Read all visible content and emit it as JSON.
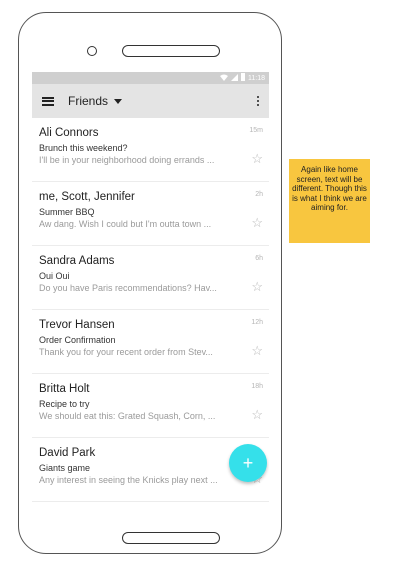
{
  "status_bar": {
    "time": "11:18"
  },
  "app_bar": {
    "title": "Friends"
  },
  "messages": [
    {
      "name": "Ali Connors",
      "subject": "Brunch this weekend?",
      "preview": "I'll be in your neighborhood doing errands ...",
      "time": "15m"
    },
    {
      "name": "me, Scott, Jennifer",
      "subject": "Summer BBQ",
      "preview": "Aw dang. Wish I could but I'm outta town ...",
      "time": "2h"
    },
    {
      "name": "Sandra Adams",
      "subject": "Oui Oui",
      "preview": "Do you have Paris recommendations? Hav...",
      "time": "6h"
    },
    {
      "name": "Trevor Hansen",
      "subject": "Order Confirmation",
      "preview": "Thank you for your recent order from Stev...",
      "time": "12h"
    },
    {
      "name": "Britta Holt",
      "subject": "Recipe to try",
      "preview": "We should eat this: Grated Squash, Corn, ...",
      "time": "18h"
    },
    {
      "name": "David Park",
      "subject": "Giants game",
      "preview": "Any interest in seeing the Knicks play next ...",
      "time": ""
    }
  ],
  "fab": {
    "label": "+"
  },
  "note": {
    "text": "Again like home screen, text will be different. Though this is what I think we are aiming for."
  },
  "icons": {
    "menu": "menu-icon",
    "dropdown": "caret-down-icon",
    "more": "more-vert-icon",
    "star": "star-outline-icon",
    "wifi": "wifi-icon",
    "signal": "signal-icon",
    "battery": "battery-icon"
  },
  "colors": {
    "fab": "#35e0ea",
    "note": "#f8c63f",
    "app_bar": "#e4e4e4",
    "status_bar": "#cfcfcf"
  }
}
